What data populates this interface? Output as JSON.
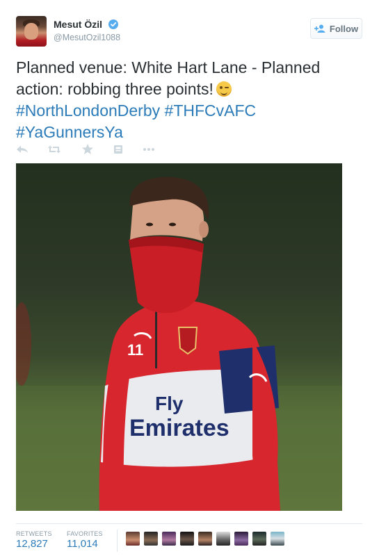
{
  "author": {
    "display_name": "Mesut Özil",
    "screen_name": "@MesutOzil1088",
    "avatar_icon": "profile-photo"
  },
  "follow_button": {
    "label": "Follow",
    "icon": "add-user-icon"
  },
  "tweet": {
    "line1": "Planned venue: White Hart Lane - Planned",
    "line2": "action: robbing three points!",
    "hashtag1": "#NorthLondonDerby",
    "hashtag2": "#THFCvAFC",
    "hashtag3": "#YaGunnersYa",
    "emoji": "winking-face-emoji"
  },
  "actions": [
    "reply-icon",
    "retweet-icon",
    "favorite-icon",
    "save-icon",
    "more-icon"
  ],
  "photo": {
    "kit_sponsor_line1": "Fly",
    "kit_sponsor_line2": "Emirates",
    "number": "11"
  },
  "stats": {
    "retweets_label": "RETWEETS",
    "retweets_value": "12,827",
    "favorites_label": "FAVORITES",
    "favorites_value": "11,014"
  },
  "favorited_by_avatars": 9,
  "colors": {
    "link": "#2b7bb9",
    "muted": "#8899a6",
    "text": "#292f33",
    "verified": "#55acee",
    "kit_red": "#d7262e",
    "kit_navy": "#1f2f6b"
  }
}
